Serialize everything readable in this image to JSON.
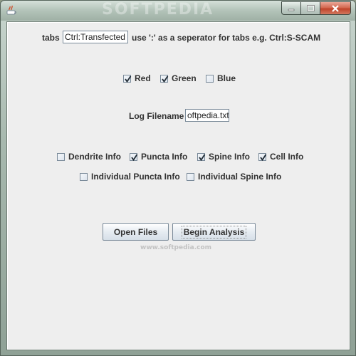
{
  "window": {
    "controls": {
      "minimize": "minimize",
      "maximize": "maximize",
      "close": "close"
    }
  },
  "tabs": {
    "label": "tabs",
    "value": "Ctrl:Transfected",
    "hint": "use ':' as a seperator for tabs e.g. Ctrl:S-SCAM"
  },
  "channels": [
    {
      "label": "Red",
      "checked": true
    },
    {
      "label": "Green",
      "checked": true
    },
    {
      "label": "Blue",
      "checked": false
    }
  ],
  "log": {
    "label": "Log Filename",
    "value": "oftpedia.txt"
  },
  "info_row1": [
    {
      "label": "Dendrite Info",
      "checked": false
    },
    {
      "label": "Puncta Info",
      "checked": true
    },
    {
      "label": "Spine Info",
      "checked": true
    },
    {
      "label": "Cell Info",
      "checked": true
    }
  ],
  "info_row2": [
    {
      "label": "Individual Puncta Info",
      "checked": false
    },
    {
      "label": "Individual Spine Info",
      "checked": false
    }
  ],
  "buttons": {
    "open_files": "Open Files",
    "begin_analysis": "Begin Analysis"
  },
  "watermark": {
    "title": "SOFTPEDIA",
    "url": "www.softpedia.com"
  },
  "colors": {
    "panel": "#eeeeee",
    "close_button": "#c0432a",
    "text": "#333333"
  }
}
